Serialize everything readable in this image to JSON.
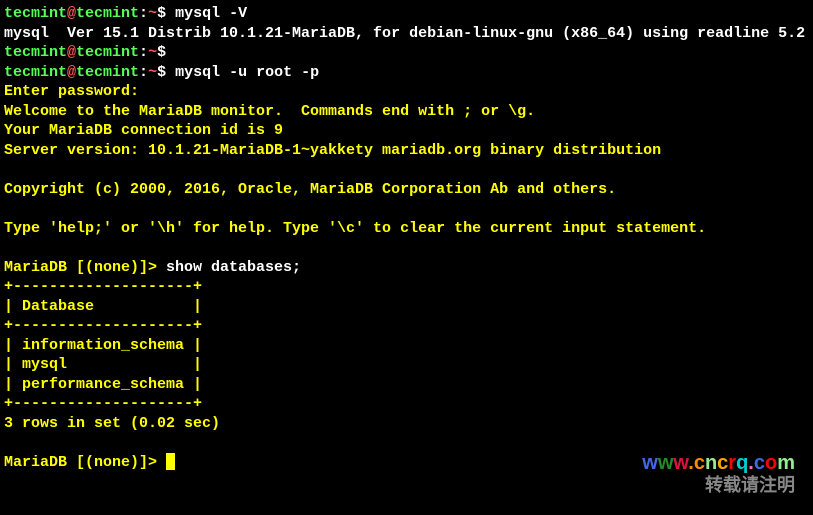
{
  "prompt": {
    "user": "tecmint",
    "host": "tecmint",
    "path": "~",
    "symbol": "$"
  },
  "commands": {
    "cmd1": "mysql -V",
    "cmd2": "",
    "cmd3": "mysql -u root -p"
  },
  "version_output": "mysql  Ver 15.1 Distrib 10.1.21-MariaDB, for debian-linux-gnu (x86_64) using readline 5.2",
  "login": {
    "enter_password": "Enter password:",
    "welcome": "Welcome to the MariaDB monitor.  Commands end with ; or \\g.",
    "conn_id": "Your MariaDB connection id is 9",
    "server_version": "Server version: 10.1.21-MariaDB-1~yakkety mariadb.org binary distribution",
    "copyright": "Copyright (c) 2000, 2016, Oracle, MariaDB Corporation Ab and others.",
    "help": "Type 'help;' or '\\h' for help. Type '\\c' to clear the current input statement."
  },
  "mariadb_prompt": "MariaDB [(none)]> ",
  "query": "show databases;",
  "table": {
    "border": "+--------------------+",
    "header": "| Database           |",
    "rows": [
      "| information_schema |",
      "| mysql              |",
      "| performance_schema |"
    ]
  },
  "result": "3 rows in set (0.02 sec)",
  "watermark": {
    "url": "www.cncrq.com",
    "note": "转载请注明"
  },
  "chart_data": {
    "type": "table",
    "title": "show databases;",
    "columns": [
      "Database"
    ],
    "rows": [
      [
        "information_schema"
      ],
      [
        "mysql"
      ],
      [
        "performance_schema"
      ]
    ],
    "row_count": 3,
    "query_time_sec": 0.02
  }
}
